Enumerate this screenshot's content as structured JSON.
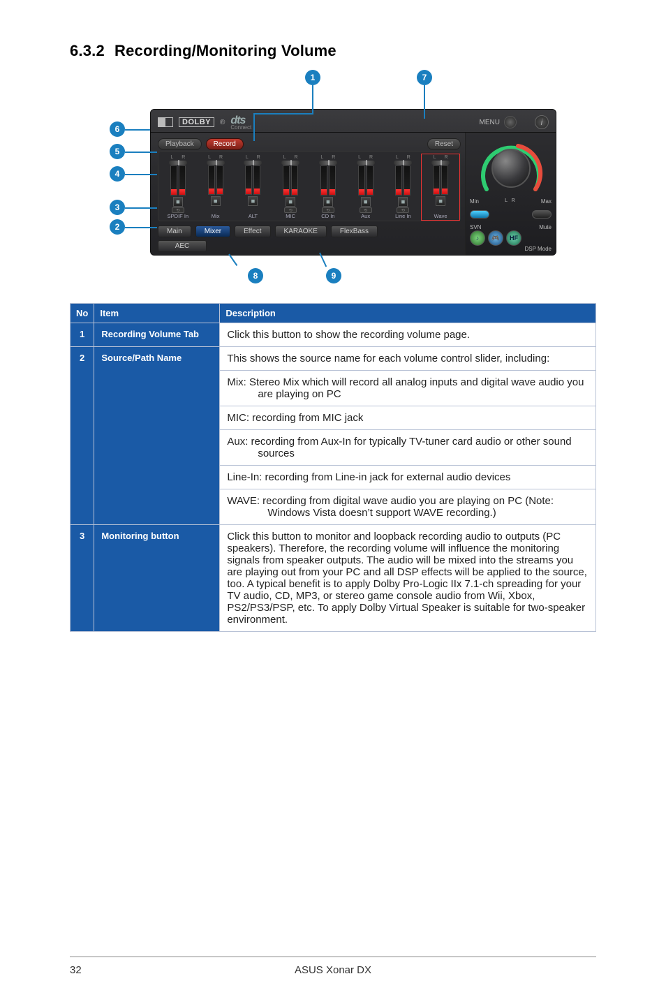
{
  "section": {
    "number": "6.3.2",
    "title": "Recording/Monitoring Volume"
  },
  "callouts": {
    "c1": "1",
    "c2": "2",
    "c3": "3",
    "c4": "4",
    "c5": "5",
    "c6": "6",
    "c7": "7",
    "c8": "8",
    "c9": "9"
  },
  "app": {
    "dolby_logo": "DOLBY",
    "reg": "®",
    "dts": "dts",
    "dts_sub": "Connect",
    "menu_label": "MENU",
    "info": "i",
    "tab_playback": "Playback",
    "tab_record": "Record",
    "reset": "Reset",
    "ch_lr_l": "L",
    "ch_lr_r": "R",
    "channels": [
      "SPDIF In",
      "Mix",
      "ALT",
      "MIC",
      "CD In",
      "Aux",
      "Line In",
      "Wave"
    ],
    "bottom": {
      "main": "Main",
      "mixer": "Mixer",
      "effect": "Effect",
      "karaoke": "KARAOKE",
      "flexbass": "FlexBass"
    },
    "aec": "AEC",
    "right": {
      "min": "Min",
      "max": "Max",
      "svn": "SVN",
      "mute": "Mute",
      "dsp": "DSP Mode",
      "hf": "HF"
    }
  },
  "table": {
    "headers": {
      "no": "No",
      "item": "Item",
      "desc": "Description"
    },
    "rows": {
      "r1": {
        "no": "1",
        "item": "Recording Volume Tab",
        "desc": "Click this button to show the recording volume page."
      },
      "r2": {
        "no": "2",
        "item": "Source/Path Name",
        "intro": "This shows the source name for each volume control slider, including:",
        "mix": "Mix: Stereo Mix which will record all analog inputs and digital wave audio you are playing on PC",
        "mic": "MIC: recording from MIC jack",
        "aux": "Aux: recording from Aux-In for typically TV-tuner card audio or other sound sources",
        "linein": "Line-In: recording from Line-in jack for external audio devices",
        "wave": "WAVE: recording from digital wave audio you are playing on PC (Note: Windows Vista doesn’t support WAVE recording.)"
      },
      "r3": {
        "no": "3",
        "item": "Monitoring button",
        "desc": "Click this button to monitor and loopback recording audio to outputs (PC speakers). Therefore, the recording volume will influence the monitoring signals from speaker outputs. The audio will be mixed into the streams you are playing out from your PC and all DSP effects will be applied to the source, too. A typical benefit is to apply Dolby Pro-Logic IIx 7.1-ch spreading for your TV audio, CD, MP3, or stereo game console audio from Wii, Xbox, PS2/PS3/PSP, etc. To apply Dolby Virtual Speaker is suitable for two-speaker environment."
      }
    }
  },
  "footer": {
    "page": "32",
    "product": "ASUS Xonar DX"
  }
}
